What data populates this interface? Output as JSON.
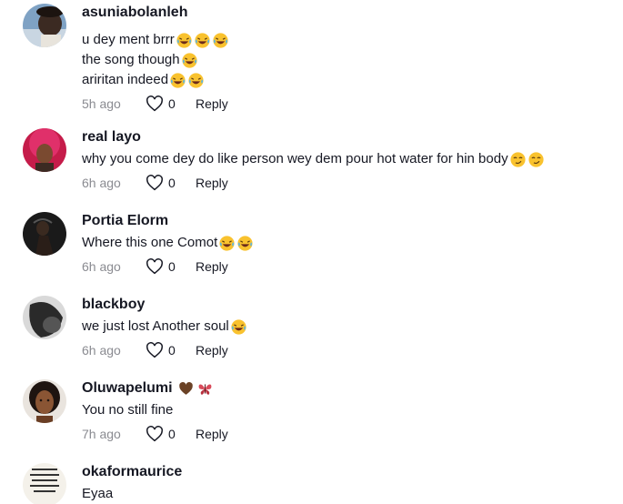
{
  "comments": [
    {
      "username": "asuniabolanleh",
      "lines": [
        {
          "text": "u dey ment brrr",
          "emojis": [
            "laughing-emoji",
            "laughing-emoji",
            "laughing-emoji"
          ]
        },
        {
          "text": "the song though",
          "emojis": [
            "laughing-emoji"
          ]
        },
        {
          "text": "ariritan indeed",
          "emojis": [
            "laughing-emoji",
            "laughing-emoji"
          ]
        }
      ],
      "time": "5h ago",
      "likes": "0",
      "reply": "Reply"
    },
    {
      "username": "real layo",
      "lines": [
        {
          "text": "why you come dey do like person wey dem pour hot water for hin body",
          "emojis": [
            "smirk-emoji",
            "smirk-emoji"
          ]
        }
      ],
      "time": "6h ago",
      "likes": "0",
      "reply": "Reply"
    },
    {
      "username": "Portia Elorm",
      "lines": [
        {
          "text": "Where this one Comot ",
          "emojis": [
            "laughing-emoji",
            "laughing-emoji"
          ]
        }
      ],
      "time": "6h ago",
      "likes": "0",
      "reply": "Reply"
    },
    {
      "username": "blackboy",
      "lines": [
        {
          "text": "we just lost Another soul ",
          "emojis": [
            "laughing-emoji"
          ]
        }
      ],
      "time": "6h ago",
      "likes": "0",
      "reply": "Reply"
    },
    {
      "username": "Oluwapelumi",
      "badges": [
        "brown-heart-emoji",
        "butterfly-emoji"
      ],
      "lines": [
        {
          "text": "You no still fine",
          "emojis": []
        }
      ],
      "time": "7h ago",
      "likes": "0",
      "reply": "Reply"
    },
    {
      "username": "okaformaurice",
      "lines": [
        {
          "text": "Eyaa",
          "emojis": []
        }
      ]
    }
  ],
  "colors": {
    "text": "#161823",
    "meta": "#8a8b91",
    "emoji_face": "#f9c22e",
    "heart": "#6b4226",
    "butterfly": "#d94a5a"
  }
}
